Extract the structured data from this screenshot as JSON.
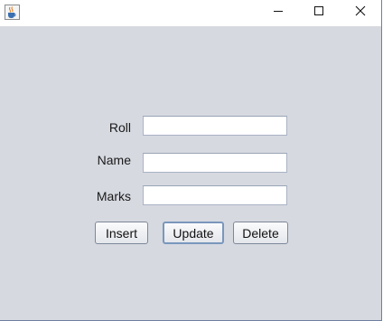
{
  "window": {
    "icon": "java-cup-icon",
    "controls": {
      "minimize_icon": "minimize-icon",
      "maximize_icon": "maximize-icon",
      "close_icon": "close-icon"
    }
  },
  "form": {
    "fields": [
      {
        "label": "Roll",
        "value": ""
      },
      {
        "label": "Name",
        "value": ""
      },
      {
        "label": "Marks",
        "value": ""
      }
    ],
    "buttons": {
      "insert": "Insert",
      "update": "Update",
      "delete": "Delete"
    }
  },
  "colors": {
    "panel_background": "#d6d9e0",
    "focus_border": "#7a97bd"
  }
}
